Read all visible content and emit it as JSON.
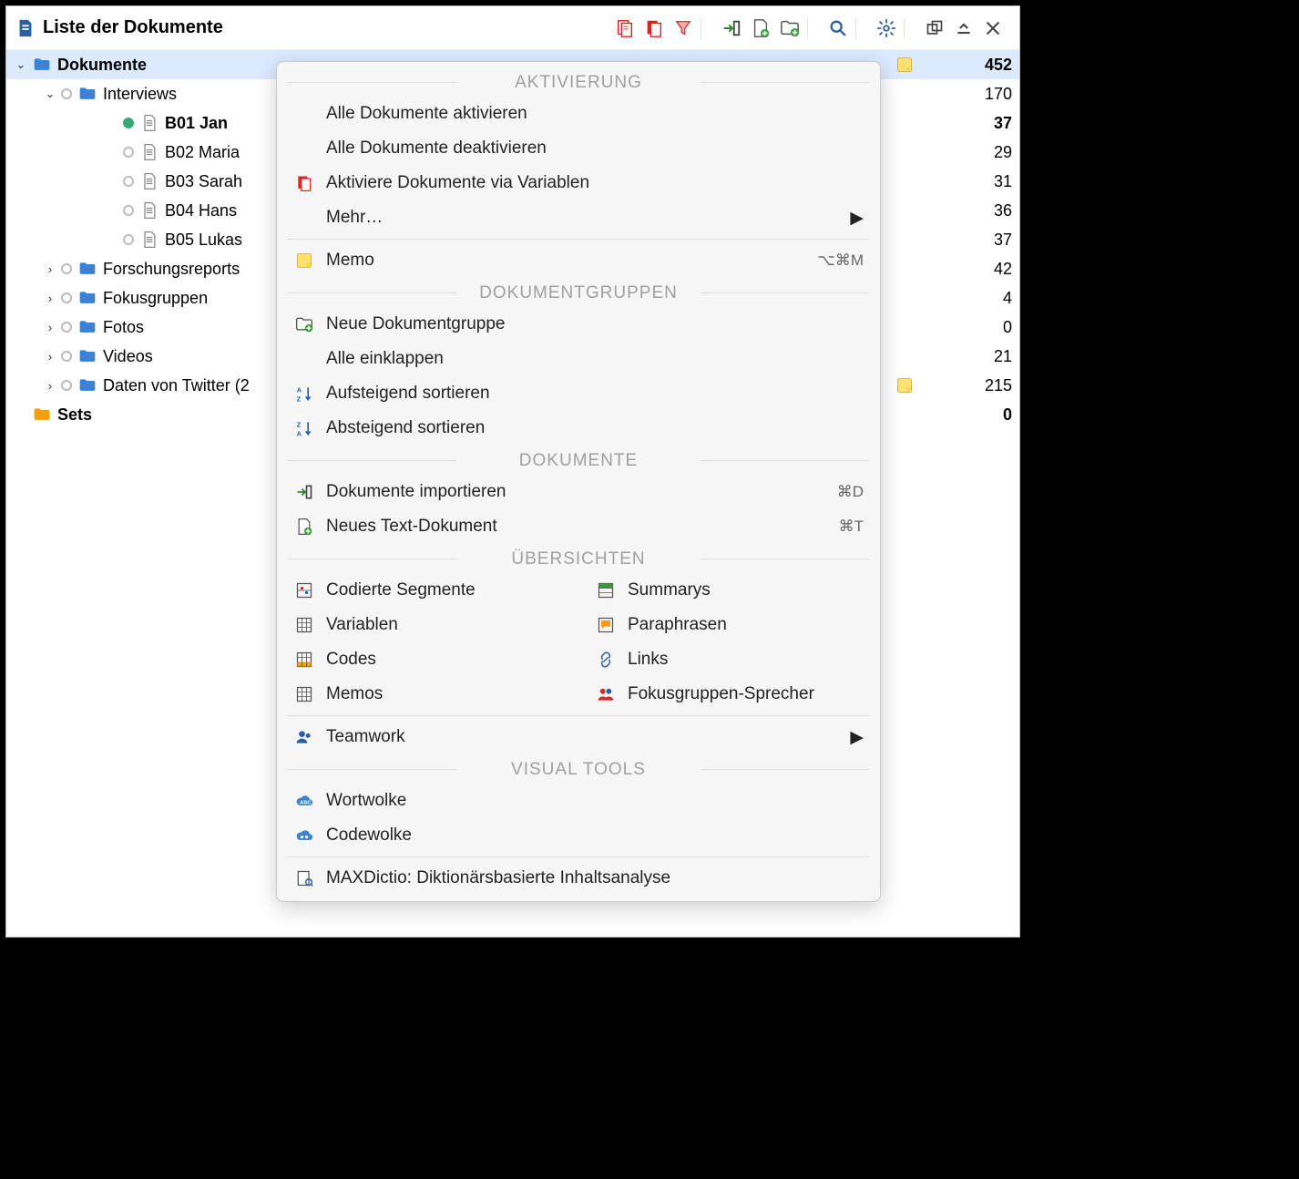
{
  "title": "Liste der Dokumente",
  "toolbar": {
    "icons": [
      "activate-docs",
      "copy-docs",
      "filter-docs",
      "import",
      "new-doc",
      "new-group",
      "search",
      "settings",
      "popout",
      "collapse-up",
      "close"
    ]
  },
  "tree": [
    {
      "level": 0,
      "expand": "open",
      "icon": "folder",
      "label": "Dokumente",
      "bold": true,
      "selected": true,
      "memo": true,
      "count": 452
    },
    {
      "level": 1,
      "expand": "open",
      "dot": true,
      "icon": "folder",
      "label": "Interviews",
      "count": 170
    },
    {
      "level": 2,
      "dot": true,
      "dotGreen": true,
      "icon": "doc",
      "label": "B01 Jan",
      "bold": true,
      "count": 37
    },
    {
      "level": 2,
      "dot": true,
      "icon": "doc",
      "label": "B02 Maria",
      "count": 29
    },
    {
      "level": 2,
      "dot": true,
      "icon": "doc",
      "label": "B03 Sarah",
      "count": 31
    },
    {
      "level": 2,
      "dot": true,
      "icon": "doc",
      "label": "B04 Hans",
      "count": 36
    },
    {
      "level": 2,
      "dot": true,
      "icon": "doc",
      "label": "B05 Lukas",
      "count": 37
    },
    {
      "level": 1,
      "expand": "closed",
      "dot": true,
      "icon": "folder",
      "label": "Forschungsreports",
      "count": 42
    },
    {
      "level": 1,
      "expand": "closed",
      "dot": true,
      "icon": "folder",
      "label": "Fokusgruppen",
      "count": 4
    },
    {
      "level": 1,
      "expand": "closed",
      "dot": true,
      "icon": "folder",
      "label": "Fotos",
      "count": 0
    },
    {
      "level": 1,
      "expand": "closed",
      "dot": true,
      "icon": "folder",
      "label": "Videos",
      "count": 21
    },
    {
      "level": 1,
      "expand": "closed",
      "dot": true,
      "icon": "folder",
      "label": "Daten von Twitter (2",
      "memo": true,
      "count": 215
    },
    {
      "level": 0,
      "icon": "folder-orange",
      "label": "Sets",
      "bold": true,
      "count": 0
    }
  ],
  "menu": {
    "sections": {
      "activation": "AKTIVIERUNG",
      "docgroups": "DOKUMENTGRUPPEN",
      "documents": "DOKUMENTE",
      "overviews": "ÜBERSICHTEN",
      "visual": "VISUAL TOOLS"
    },
    "items": {
      "activateAll": "Alle Dokumente aktivieren",
      "deactivateAll": "Alle Dokumente deaktivieren",
      "activateViaVar": "Aktiviere Dokumente via Variablen",
      "more": "Mehr…",
      "memo": "Memo",
      "memoAccel": "⌥⌘M",
      "newGroup": "Neue Dokumentgruppe",
      "collapseAll": "Alle einklappen",
      "sortAsc": "Aufsteigend sortieren",
      "sortDesc": "Absteigend sortieren",
      "importDocs": "Dokumente importieren",
      "importAccel": "⌘D",
      "newTextDoc": "Neues Text-Dokument",
      "newTextAccel": "⌘T",
      "codedSegments": "Codierte Segmente",
      "variables": "Variablen",
      "codes": "Codes",
      "memos": "Memos",
      "summaries": "Summarys",
      "paraphrases": "Paraphrasen",
      "links": "Links",
      "focusSpeakers": "Fokusgruppen-Sprecher",
      "teamwork": "Teamwork",
      "wordcloud": "Wortwolke",
      "codecloud": "Codewolke",
      "maxdictio": "MAXDictio: Diktionärsbasierte Inhaltsanalyse"
    }
  }
}
